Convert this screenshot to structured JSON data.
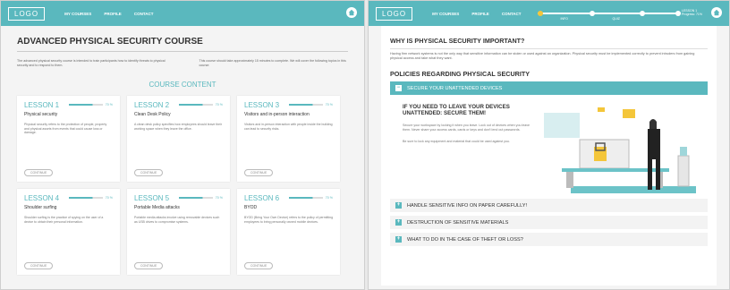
{
  "left": {
    "logo": "LOGO",
    "nav": [
      "MY COURSES",
      "PROFILE",
      "CONTACT"
    ],
    "course_title": "ADVANCED PHYSICAL SECURITY COURSE",
    "intro_left": "The advanced physical security course is intended to train participants how to identify threats to physical security and to respond to them.",
    "intro_right": "This course should take approximately 15 minutes to complete. We will cover the following topics in this course:",
    "section_title": "COURSE CONTENT",
    "lessons": [
      {
        "num": "LESSON 1",
        "pct": "70 %",
        "progress": 70,
        "title": "Physical security",
        "desc": "Physical security refers to the protection of people, property and physical assets from events that could cause loss or damage.",
        "btn": "CONTINUE"
      },
      {
        "num": "LESSON 2",
        "pct": "70 %",
        "progress": 70,
        "title": "Clean Desk Policy",
        "desc": "A clean desk policy specifies how employees should leave their working space when they leave the office.",
        "btn": "CONTINUE"
      },
      {
        "num": "LESSON 3",
        "pct": "70 %",
        "progress": 70,
        "title": "Visitors and in-person interaction",
        "desc": "Visitors and in-person interaction with people inside the building can lead to security risks.",
        "btn": "CONTINUE"
      },
      {
        "num": "LESSON 4",
        "pct": "70 %",
        "progress": 70,
        "title": "Shoulder surfing",
        "desc": "Shoulder surfing is the practice of spying on the user of a device to obtain their personal information.",
        "btn": "CONTINUE"
      },
      {
        "num": "LESSON 5",
        "pct": "70 %",
        "progress": 70,
        "title": "Portable Media attacks",
        "desc": "Portable media attacks involve using removable devices such as USB drives to compromise systems.",
        "btn": "CONTINUE"
      },
      {
        "num": "LESSON 6",
        "pct": "70 %",
        "progress": 70,
        "title": "BYOD",
        "desc": "BYOD (Bring Your Own Device) refers to the policy of permitting employees to bring personally owned mobile devices.",
        "btn": "CONTINUE"
      }
    ]
  },
  "right": {
    "logo": "LOGO",
    "nav": [
      "MY COURSES",
      "PROFILE",
      "CONTACT"
    ],
    "progress_labels": [
      "INFO",
      "QUIZ"
    ],
    "status_line1": "LESSON 1",
    "status_line2": "Progress: 71%",
    "heading": "WHY IS PHYSICAL SECURITY IMPORTANT?",
    "para": "Having firm network systems is not the only way that sensitive information can be stolen or used against an organization. Physical security must be implemented correctly to prevent intruders from gaining physical access and take what they want.",
    "policies_heading": "POLICIES REGARDING PHYSICAL SECURITY",
    "accordion": [
      {
        "label": "SECURE YOUR UNATTENDED DEVICES",
        "open": true
      },
      {
        "label": "HANDLE SENSITIVE INFO ON PAPER CAREFULLY!",
        "open": false
      },
      {
        "label": "DESTRUCTION OF SENSITIVE MATERIALS",
        "open": false
      },
      {
        "label": "WHAT TO DO IN THE CASE OF THEFT OR LOSS?",
        "open": false
      }
    ],
    "open_heading": "IF YOU NEED TO LEAVE YOUR DEVICES UNATTENDED: SECURE THEM!",
    "open_para1": "Secure your workspace by locking it when you leave. Lock out of devices when you leave them. Never share your access cards, cards or keys and don't lend out passwords.",
    "open_para2": "Be sure to lock any equipment and material that could be used against you."
  },
  "colors": {
    "accent": "#5ab8be",
    "highlight": "#f4c63a"
  }
}
